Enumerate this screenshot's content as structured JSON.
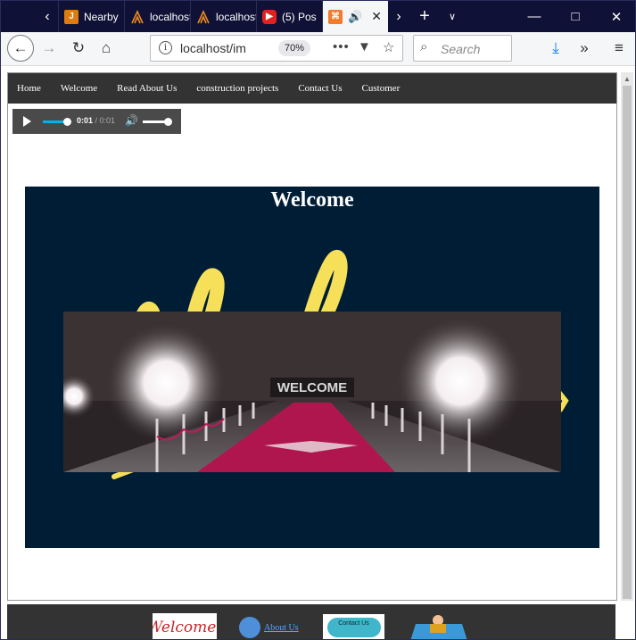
{
  "browser": {
    "tabs": [
      {
        "label": "Nearby",
        "favicon": "j-favicon"
      },
      {
        "label": "localhost",
        "favicon": "xampp-favicon"
      },
      {
        "label": "localhost",
        "favicon": "xampp-favicon"
      },
      {
        "label": "(5) Pos",
        "favicon": "youtube-favicon"
      },
      {
        "label": "",
        "favicon": "xampp-orange-favicon",
        "active": true
      }
    ],
    "url": "localhost/im",
    "zoom": "70%",
    "search_placeholder": "Search"
  },
  "page": {
    "menu": [
      "Home",
      "Welcome",
      "Read About Us",
      "construction projects",
      "Contact Us",
      "Customer"
    ],
    "audio": {
      "current": "0:01",
      "duration": "/ 0:01",
      "progress": 1.0,
      "volume": 1.0
    },
    "hero_title": "Welcome",
    "video_overlay_text": "WELCOME",
    "footer": {
      "welcome_badge": "Welcome!",
      "about_link": "About Us",
      "contact_badge": "Contact Us"
    }
  },
  "colors": {
    "tabbar": "#0f1136",
    "menu": "#333333",
    "hero_bg": "#001d36",
    "audio_accent": "#00b3f0"
  }
}
